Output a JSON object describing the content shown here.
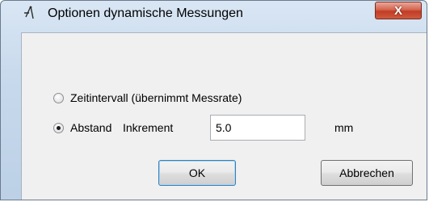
{
  "window": {
    "title": "Optionen dynamische Messungen",
    "close_label": "X"
  },
  "options": {
    "time_interval_label": "Zeitintervall (übernimmt Messrate)",
    "distance_label": "Abstand",
    "selected": "distance"
  },
  "increment": {
    "label": "Inkrement",
    "value": "5.0",
    "unit": "mm"
  },
  "buttons": {
    "ok_label": "OK",
    "cancel_label": "Abbrechen"
  },
  "icons": {
    "app": "compass-icon",
    "close": "close-icon"
  }
}
